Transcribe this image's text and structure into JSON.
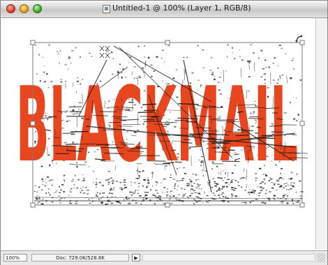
{
  "window": {
    "title": "Untitled-1 @ 100% (Layer 1, RGB/8)"
  },
  "canvas": {
    "text": "BLACKMAIL",
    "text_color": "#e8461e",
    "grunge_color": "#1a1a1a",
    "selection_color": "#7a7a7a"
  },
  "status": {
    "zoom": "100%",
    "doc_info": "Doc: 729.0K/528.8K",
    "arrow": "▶"
  },
  "icons": {
    "close": "close-button-icon",
    "minimize": "minimize-button-icon",
    "zoom": "zoom-button-icon",
    "document": "document-icon",
    "rotate": "rotate-cursor-icon",
    "grow": "resize-grip-icon"
  }
}
